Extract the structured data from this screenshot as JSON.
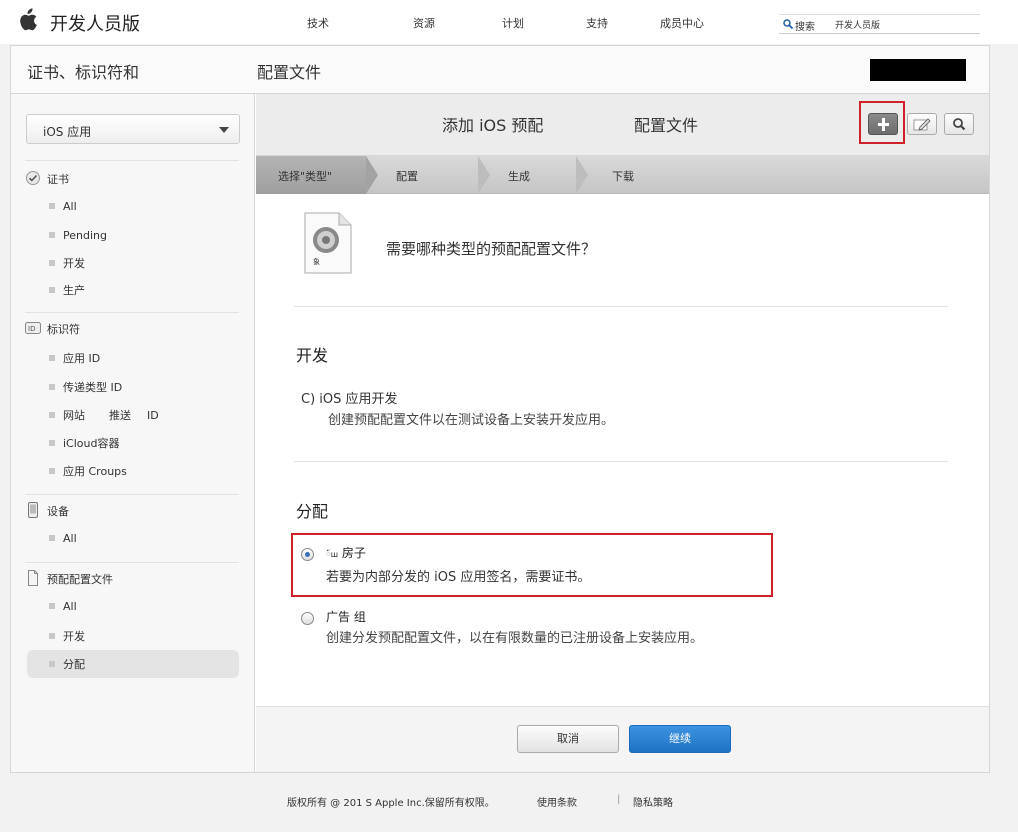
{
  "nav": {
    "brand": "开发人员版",
    "items": [
      "技术",
      "资源",
      "计划",
      "支持",
      "成员中心"
    ],
    "search_label": "搜索",
    "search_value": "开发人员版"
  },
  "header": {
    "crumb_left": "证书、标识符和",
    "crumb_right": "配置文件"
  },
  "sidebar": {
    "platform": "iOS 应用",
    "sections": [
      {
        "title": "证书",
        "icon": "certificate-icon",
        "items": [
          "All",
          "Pending",
          "开发",
          "生产"
        ]
      },
      {
        "title": "标识符",
        "icon": "id-icon",
        "items": [
          "应用 ID",
          "传递类型 ID",
          "网站",
          "iCloud容器",
          "应用 Croups"
        ]
      },
      {
        "title": "设备",
        "icon": "device-icon",
        "items": [
          "All"
        ]
      },
      {
        "title": "预配配置文件",
        "icon": "profile-icon",
        "items": [
          "All",
          "开发",
          "分配"
        ]
      }
    ],
    "website_push_a": "网站",
    "website_push_b": "推送",
    "website_push_c": "ID"
  },
  "content": {
    "title_a": "添加 iOS 预配",
    "title_b": "配置文件",
    "steps": [
      "选择\"类型\"",
      "配置",
      "生成",
      "下载"
    ],
    "icon_caption": "象",
    "question": "需要哪种类型的预配配置文件？",
    "dev_heading": "开发",
    "dev_option": "C) iOS 应用开发",
    "dev_desc": "创建预配配置文件以在测试设备上安装开发应用。",
    "dist_heading": "分配",
    "opt1_prefix": "៍ш",
    "opt1_title": "房子",
    "opt1_desc": "若要为内部分发的 iOS 应用签名，需要证书。",
    "opt2_title": "广告 组",
    "opt2_desc": "创建分发预配配置文件，以在有限数量的已注册设备上安装应用。",
    "cancel": "取消",
    "continue": "继续"
  },
  "footer": {
    "copyright": "版权所有 @ 201 S Apple Inc.保留所有权限。",
    "terms": "使用条款",
    "sep": "|",
    "privacy": "隐私策略"
  },
  "colors": {
    "highlight_red": "#d0202a",
    "primary_blue": "#1f73c5"
  }
}
